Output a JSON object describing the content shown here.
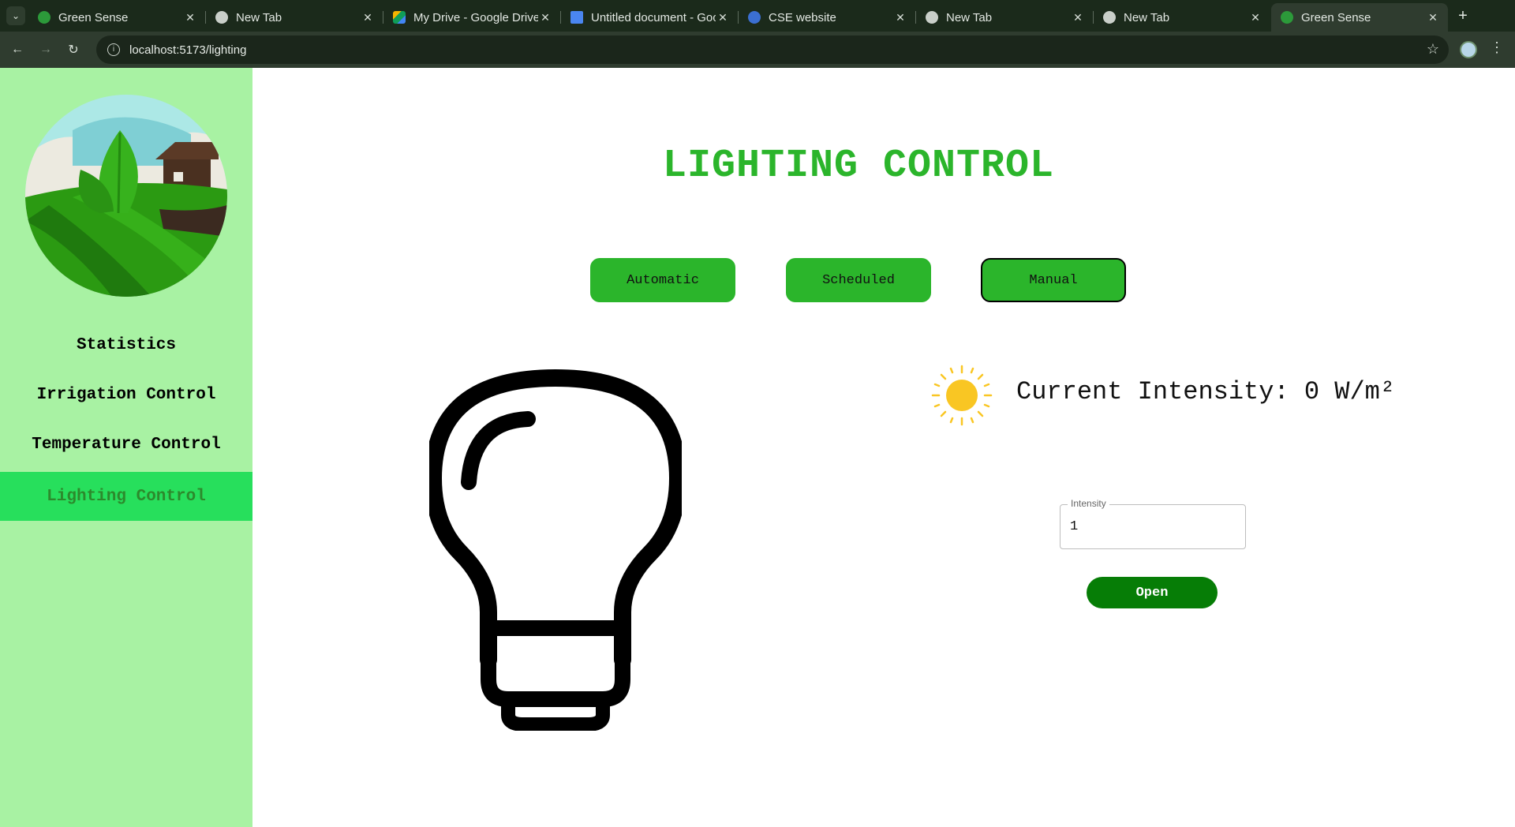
{
  "browser": {
    "tabs": [
      {
        "title": "Green Sense",
        "favicon": "globe-green-icon",
        "active": false
      },
      {
        "title": "New Tab",
        "favicon": "chrome-icon",
        "active": false
      },
      {
        "title": "My Drive - Google Drive",
        "favicon": "google-drive-icon",
        "active": false
      },
      {
        "title": "Untitled document - Google Docs",
        "favicon": "google-docs-icon",
        "active": false
      },
      {
        "title": "CSE website",
        "favicon": "site-icon",
        "active": false
      },
      {
        "title": "New Tab",
        "favicon": "chrome-icon",
        "active": false
      },
      {
        "title": "New Tab",
        "favicon": "chrome-icon",
        "active": false
      },
      {
        "title": "Green Sense",
        "favicon": "globe-green-icon",
        "active": true
      }
    ],
    "url": "localhost:5173/lighting"
  },
  "sidebar": {
    "items": [
      {
        "label": "Statistics",
        "active": false
      },
      {
        "label": "Irrigation Control",
        "active": false
      },
      {
        "label": "Temperature Control",
        "active": false
      },
      {
        "label": "Lighting Control",
        "active": true
      }
    ]
  },
  "main": {
    "title": "LIGHTING CONTROL",
    "modes": [
      {
        "label": "Automatic",
        "selected": false
      },
      {
        "label": "Scheduled",
        "selected": false
      },
      {
        "label": "Manual",
        "selected": true
      }
    ],
    "intensity_text": "Current Intensity: 0 W/m²",
    "input": {
      "label": "Intensity",
      "value": "1"
    },
    "open_label": "Open"
  },
  "colors": {
    "sidebar_bg": "#a8f2a3",
    "active_nav_bg": "#27df5c",
    "title_green": "#2bb52b",
    "open_button": "#067d06",
    "sun_yellow": "#f9c623"
  }
}
